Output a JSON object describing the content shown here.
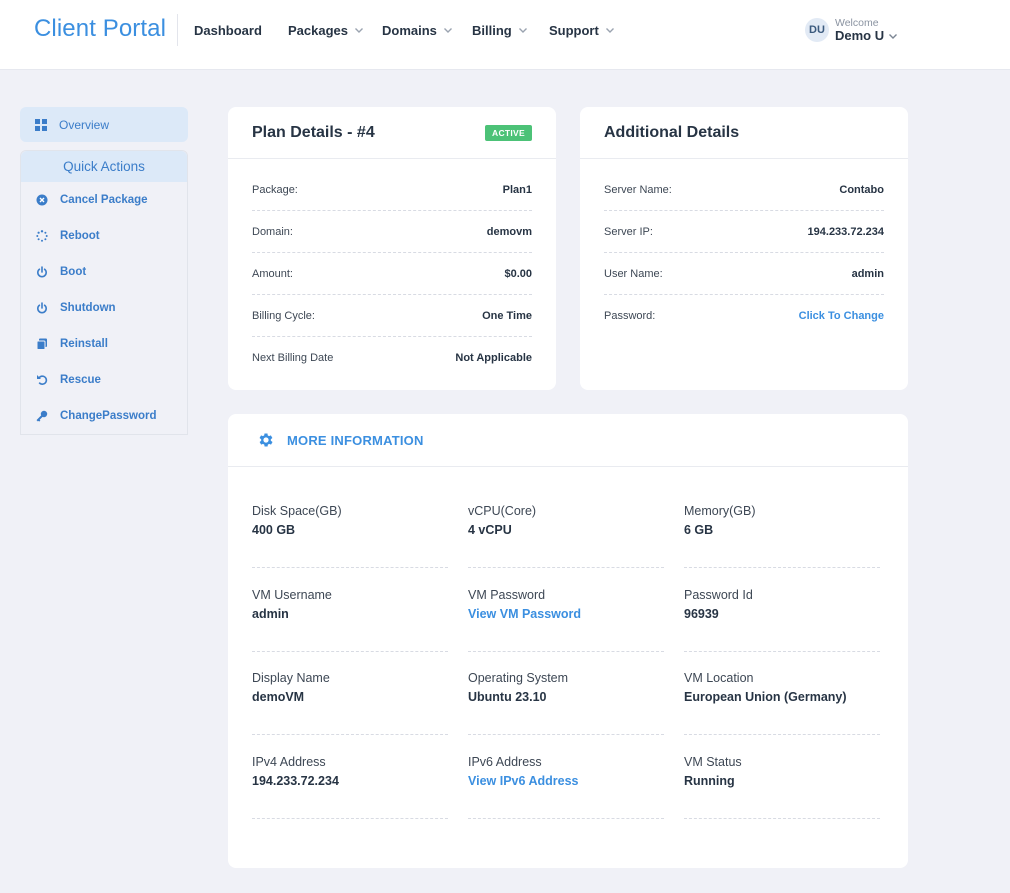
{
  "header": {
    "brand": "Client Portal",
    "nav": [
      {
        "label": "Dashboard",
        "dropdown": false
      },
      {
        "label": "Packages",
        "dropdown": true
      },
      {
        "label": "Domains",
        "dropdown": true
      },
      {
        "label": "Billing",
        "dropdown": true
      },
      {
        "label": "Support",
        "dropdown": true
      }
    ],
    "user": {
      "initials": "DU",
      "welcome": "Welcome",
      "name": "Demo U"
    }
  },
  "sidebar": {
    "overview": "Overview",
    "quick_actions_title": "Quick Actions",
    "items": [
      {
        "label": "Cancel Package",
        "icon": "cancel-circle-icon"
      },
      {
        "label": "Reboot",
        "icon": "spinner-icon"
      },
      {
        "label": "Boot",
        "icon": "power-icon"
      },
      {
        "label": "Shutdown",
        "icon": "power-icon"
      },
      {
        "label": "Reinstall",
        "icon": "copy-icon"
      },
      {
        "label": "Rescue",
        "icon": "undo-icon"
      },
      {
        "label": "ChangePassword",
        "icon": "key-icon"
      }
    ]
  },
  "plan": {
    "title": "Plan Details - #4",
    "status": "ACTIVE",
    "rows": [
      {
        "label": "Package:",
        "value": "Plan1"
      },
      {
        "label": "Domain:",
        "value": "demovm"
      },
      {
        "label": "Amount:",
        "value": "$0.00"
      },
      {
        "label": "Billing Cycle:",
        "value": "One Time"
      },
      {
        "label": "Next Billing Date",
        "value": "Not Applicable"
      }
    ]
  },
  "additional": {
    "title": "Additional Details",
    "rows": [
      {
        "label": "Server Name:",
        "value": "Contabo"
      },
      {
        "label": "Server IP:",
        "value": "194.233.72.234"
      },
      {
        "label": "User Name:",
        "value": "admin"
      },
      {
        "label": "Password:",
        "value": "Click To Change"
      }
    ]
  },
  "more": {
    "title": "MORE INFORMATION",
    "items": [
      {
        "label": "Disk Space(GB)",
        "value": "400 GB"
      },
      {
        "label": "vCPU(Core)",
        "value": "4 vCPU"
      },
      {
        "label": "Memory(GB)",
        "value": "6 GB"
      },
      {
        "label": "VM Username",
        "value": "admin"
      },
      {
        "label": "VM Password",
        "value": "View VM Password"
      },
      {
        "label": "Password Id",
        "value": "96939"
      },
      {
        "label": "Display Name",
        "value": "demoVM"
      },
      {
        "label": "Operating System",
        "value": "Ubuntu 23.10"
      },
      {
        "label": "VM Location",
        "value": "European Union (Germany)"
      },
      {
        "label": "IPv4 Address",
        "value": "194.233.72.234"
      },
      {
        "label": "IPv6 Address",
        "value": "View IPv6 Address"
      },
      {
        "label": "VM Status",
        "value": "Running"
      }
    ]
  },
  "colors": {
    "accent": "#3b8fe0",
    "active_badge": "#4cc277",
    "background": "#f0f1f7"
  }
}
